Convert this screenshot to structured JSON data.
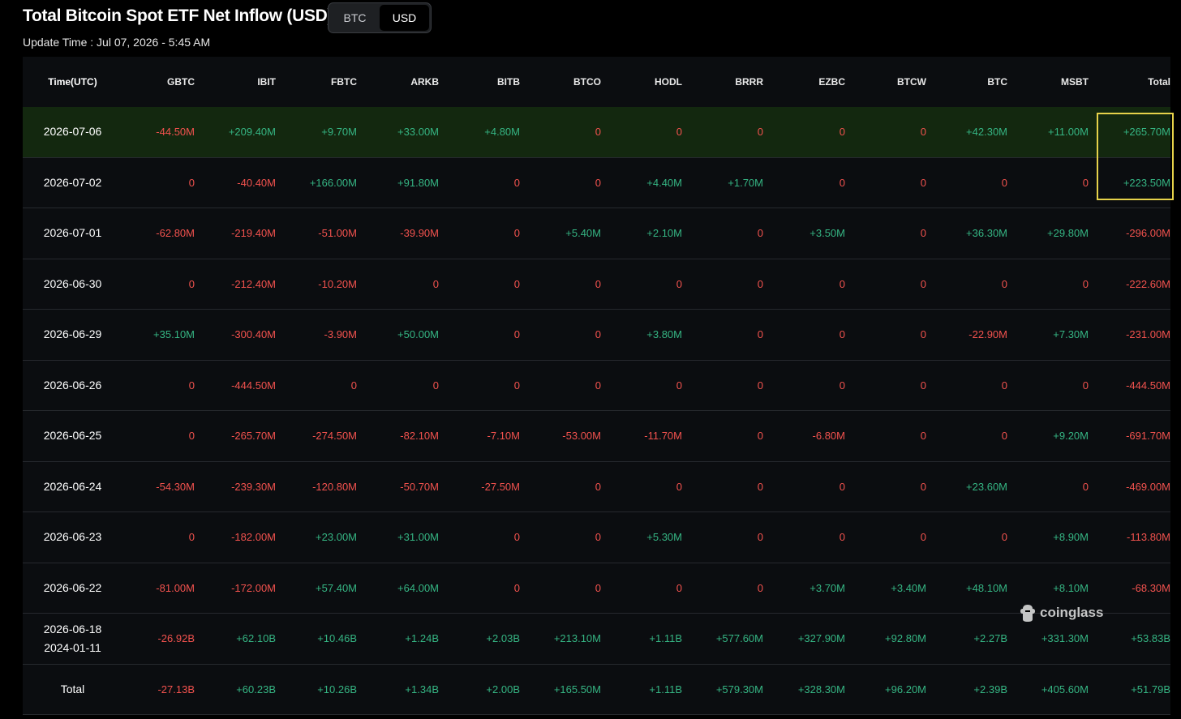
{
  "title": "Total Bitcoin Spot ETF Net Inflow (USD)",
  "toggle": {
    "options": [
      "BTC",
      "USD"
    ],
    "selected": "USD"
  },
  "update_time": "Update Time : Jul 07, 2026 - 5:45 AM",
  "columns": [
    "Time(UTC)",
    "GBTC",
    "IBIT",
    "FBTC",
    "ARKB",
    "BITB",
    "BTCO",
    "HODL",
    "BRRR",
    "EZBC",
    "BTCW",
    "BTC",
    "MSBT",
    "Total"
  ],
  "rows": [
    {
      "date": [
        "2026-07-06"
      ],
      "highlight": true,
      "values": [
        "-44.50M",
        "+209.40M",
        "+9.70M",
        "+33.00M",
        "+4.80M",
        "0",
        "0",
        "0",
        "0",
        "0",
        "+42.30M",
        "+11.00M",
        "+265.70M"
      ]
    },
    {
      "date": [
        "2026-07-02"
      ],
      "values": [
        "0",
        "-40.40M",
        "+166.00M",
        "+91.80M",
        "0",
        "0",
        "+4.40M",
        "+1.70M",
        "0",
        "0",
        "0",
        "0",
        "+223.50M"
      ]
    },
    {
      "date": [
        "2026-07-01"
      ],
      "values": [
        "-62.80M",
        "-219.40M",
        "-51.00M",
        "-39.90M",
        "0",
        "+5.40M",
        "+2.10M",
        "0",
        "+3.50M",
        "0",
        "+36.30M",
        "+29.80M",
        "-296.00M"
      ]
    },
    {
      "date": [
        "2026-06-30"
      ],
      "values": [
        "0",
        "-212.40M",
        "-10.20M",
        "0",
        "0",
        "0",
        "0",
        "0",
        "0",
        "0",
        "0",
        "0",
        "-222.60M"
      ]
    },
    {
      "date": [
        "2026-06-29"
      ],
      "values": [
        "+35.10M",
        "-300.40M",
        "-3.90M",
        "+50.00M",
        "0",
        "0",
        "+3.80M",
        "0",
        "0",
        "0",
        "-22.90M",
        "+7.30M",
        "-231.00M"
      ]
    },
    {
      "date": [
        "2026-06-26"
      ],
      "values": [
        "0",
        "-444.50M",
        "0",
        "0",
        "0",
        "0",
        "0",
        "0",
        "0",
        "0",
        "0",
        "0",
        "-444.50M"
      ]
    },
    {
      "date": [
        "2026-06-25"
      ],
      "values": [
        "0",
        "-265.70M",
        "-274.50M",
        "-82.10M",
        "-7.10M",
        "-53.00M",
        "-11.70M",
        "0",
        "-6.80M",
        "0",
        "0",
        "+9.20M",
        "-691.70M"
      ]
    },
    {
      "date": [
        "2026-06-24"
      ],
      "values": [
        "-54.30M",
        "-239.30M",
        "-120.80M",
        "-50.70M",
        "-27.50M",
        "0",
        "0",
        "0",
        "0",
        "0",
        "+23.60M",
        "0",
        "-469.00M"
      ]
    },
    {
      "date": [
        "2026-06-23"
      ],
      "values": [
        "0",
        "-182.00M",
        "+23.00M",
        "+31.00M",
        "0",
        "0",
        "+5.30M",
        "0",
        "0",
        "0",
        "0",
        "+8.90M",
        "-113.80M"
      ]
    },
    {
      "date": [
        "2026-06-22"
      ],
      "values": [
        "-81.00M",
        "-172.00M",
        "+57.40M",
        "+64.00M",
        "0",
        "0",
        "0",
        "0",
        "+3.70M",
        "+3.40M",
        "+48.10M",
        "+8.10M",
        "-68.30M"
      ]
    },
    {
      "date": [
        "2026-06-18",
        "2024-01-11"
      ],
      "values": [
        "-26.92B",
        "+62.10B",
        "+10.46B",
        "+1.24B",
        "+2.03B",
        "+213.10M",
        "+1.11B",
        "+577.60M",
        "+327.90M",
        "+92.80M",
        "+2.27B",
        "+331.30M",
        "+53.83B"
      ]
    },
    {
      "date": [
        "Total"
      ],
      "values": [
        "-27.13B",
        "+60.23B",
        "+10.26B",
        "+1.34B",
        "+2.00B",
        "+165.50M",
        "+1.11B",
        "+579.30M",
        "+328.30M",
        "+96.20M",
        "+2.39B",
        "+405.60M",
        "+51.79B"
      ]
    }
  ],
  "watermark": "coinglass",
  "colors": {
    "positive": "#35b583",
    "negative": "#f2524e",
    "highlight_row": "#13280f",
    "highlight_box": "#e6d24a"
  }
}
